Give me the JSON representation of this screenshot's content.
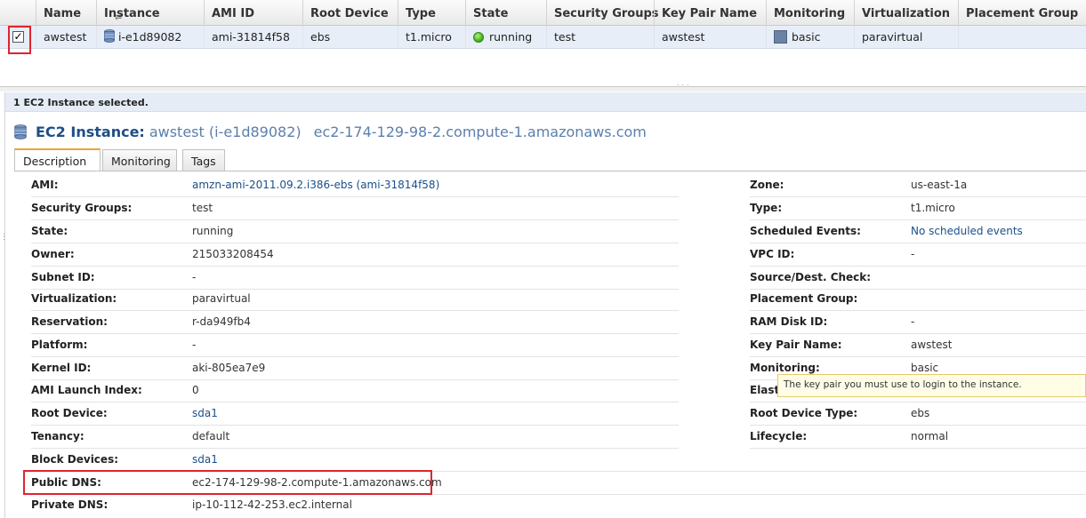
{
  "grid": {
    "columns": [
      "Name",
      "Instance",
      "AMI ID",
      "Root Device",
      "Type",
      "State",
      "Security Groups",
      "Key Pair Name",
      "Monitoring",
      "Virtualization",
      "Placement Group"
    ],
    "row": {
      "checked_mark": "✓",
      "name": "awstest",
      "instance": "i-e1d89082",
      "ami_id": "ami-31814f58",
      "root_device": "ebs",
      "type": "t1.micro",
      "state": "running",
      "security_groups": "test",
      "key_pair_name": "awstest",
      "monitoring": "basic",
      "virtualization": "paravirtual",
      "placement_group": ""
    }
  },
  "splitter": {
    "grip": "˙˙˙"
  },
  "panel": {
    "selected_text": "1 EC2 Instance selected.",
    "title_prefix": "EC2 Instance:",
    "title_name": "awstest (i-e1d89082)",
    "title_dns": "ec2-174-129-98-2.compute-1.amazonaws.com",
    "tabs": [
      "Description",
      "Monitoring",
      "Tags"
    ],
    "left_fields": [
      {
        "label": "AMI:",
        "value": "amzn-ami-2011.09.2.i386-ebs (ami-31814f58)",
        "link": true
      },
      {
        "label": "Security Groups:",
        "value": "test"
      },
      {
        "label": "State:",
        "value": "running"
      },
      {
        "label": "Owner:",
        "value": "215033208454"
      },
      {
        "label": "Subnet ID:",
        "value": "-"
      },
      {
        "label": "Virtualization:",
        "value": "paravirtual"
      },
      {
        "label": "Reservation:",
        "value": "r-da949fb4"
      },
      {
        "label": "Platform:",
        "value": "-"
      },
      {
        "label": "Kernel ID:",
        "value": "aki-805ea7e9"
      },
      {
        "label": "AMI Launch Index:",
        "value": "0"
      },
      {
        "label": "Root Device:",
        "value": "sda1",
        "link": true
      },
      {
        "label": "Tenancy:",
        "value": "default"
      },
      {
        "label": "Block Devices:",
        "value": "sda1",
        "link": true
      },
      {
        "label": "Public DNS:",
        "value": "ec2-174-129-98-2.compute-1.amazonaws.com"
      },
      {
        "label": "Private DNS:",
        "value": "ip-10-112-42-253.ec2.internal"
      }
    ],
    "right_fields": [
      {
        "label": "Zone:",
        "value": "us-east-1a"
      },
      {
        "label": "Type:",
        "value": "t1.micro"
      },
      {
        "label": "Scheduled Events:",
        "value": "No scheduled events",
        "link": true
      },
      {
        "label": "VPC ID:",
        "value": "-"
      },
      {
        "label": "Source/Dest. Check:",
        "value": ""
      },
      {
        "label": "Placement Group:",
        "value": ""
      },
      {
        "label": "RAM Disk ID:",
        "value": "-"
      },
      {
        "label": "Key Pair Name:",
        "value": "awstest"
      },
      {
        "label": "Monitoring:",
        "value": "basic"
      },
      {
        "label": "Elastic IP:",
        "value": ""
      },
      {
        "label": "Root Device Type:",
        "value": "ebs"
      },
      {
        "label": "Lifecycle:",
        "value": "normal"
      }
    ],
    "tooltip": "The key pair you must use to login to the instance."
  },
  "colors": {
    "accent_tab": "#e8a53c",
    "link": "#1a4f8b",
    "highlight": "#e0242f",
    "selected_row": "#e7eef8"
  }
}
